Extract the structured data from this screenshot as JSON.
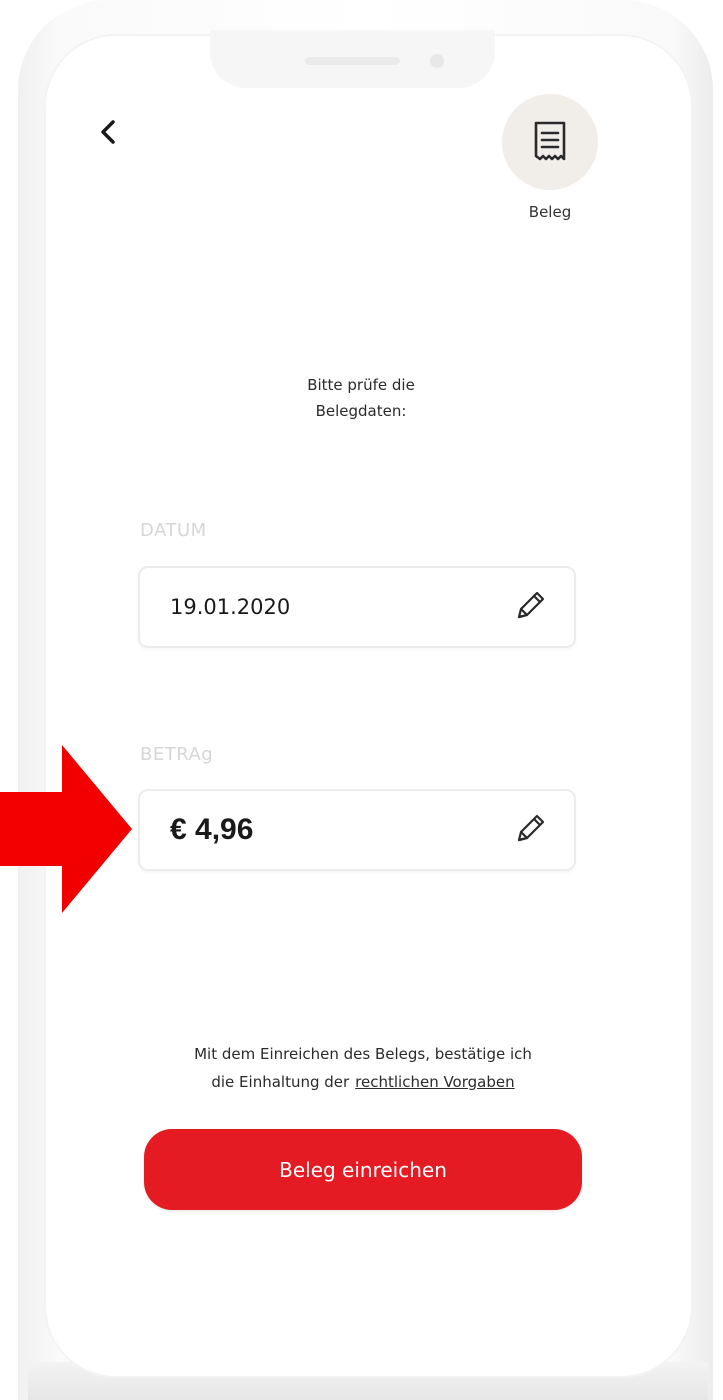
{
  "header": {
    "back_icon": "chevron-left-icon",
    "receipt_icon": "receipt-icon",
    "receipt_label": "Beleg"
  },
  "instruction": "Bitte prüfe die\nBelegdaten:",
  "fields": {
    "date": {
      "label": "DATUM",
      "value": "19.01.2020",
      "edit_icon": "pencil-icon"
    },
    "amount": {
      "label": "BETRAg",
      "value": "€ 4,96",
      "edit_icon": "pencil-icon"
    }
  },
  "legal": {
    "text_line1": "Mit dem Einreichen des Belegs, bestätige ich",
    "text_line2": "die Einhaltung der",
    "link_text": "rechtlichen Vorgaben"
  },
  "submit_label": "Beleg einreichen",
  "annotation": {
    "arrow_icon": "right-arrow-icon"
  },
  "colors": {
    "accent": "#e51b23",
    "arrow": "#f20000",
    "icon_background": "#f1eeea",
    "field_label": "#d6d6d6"
  }
}
